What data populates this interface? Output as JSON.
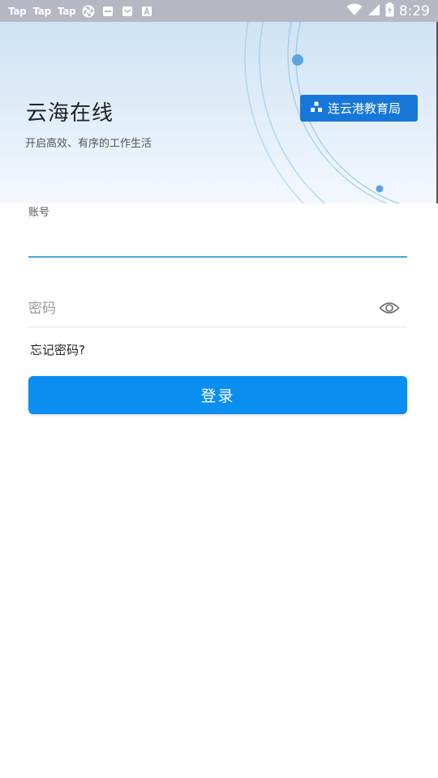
{
  "status_bar": {
    "app_icons": [
      "Tap",
      "Tap",
      "Tap"
    ],
    "icons": [
      "aperture-icon",
      "notification-icon",
      "notification-icon",
      "a-icon"
    ],
    "time": "8:29"
  },
  "header": {
    "title": "云海在线",
    "subtitle": "开启高效、有序的工作生活",
    "org_badge_label": "连云港教育局"
  },
  "login_form": {
    "account_label": "账号",
    "account_value": "",
    "password_placeholder": "密码",
    "forgot_password_label": "忘记密码?",
    "login_button_label": "登录"
  },
  "colors": {
    "accent": "#0a8ef0",
    "badge": "#1677d8",
    "input_underline": "#4aa8d8"
  }
}
